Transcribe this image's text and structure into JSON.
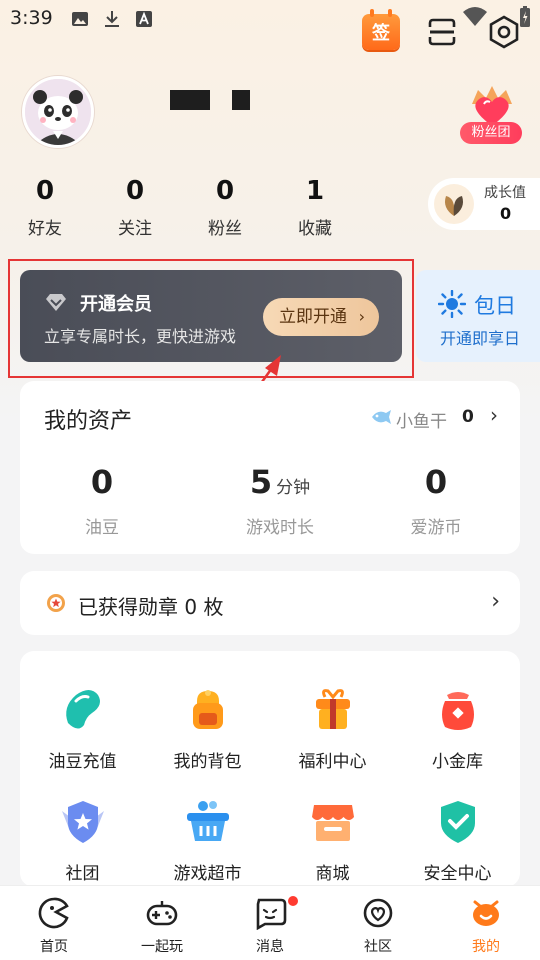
{
  "status_bar": {
    "time": "3:39"
  },
  "header": {
    "sign_label": "签"
  },
  "profile": {
    "fans_club_label": "粉丝团"
  },
  "stats": [
    {
      "value": "0",
      "label": "好友"
    },
    {
      "value": "0",
      "label": "关注"
    },
    {
      "value": "0",
      "label": "粉丝"
    },
    {
      "value": "1",
      "label": "收藏"
    }
  ],
  "growth": {
    "label": "成长值",
    "value": "0"
  },
  "membership": {
    "title": "开通会员",
    "description": "立享专属时长，更快进游戏",
    "button": "立即开通",
    "button_chevron": "›"
  },
  "package": {
    "title": "包日",
    "description": "开通即享日"
  },
  "assets": {
    "title": "我的资产",
    "fish_label": "小鱼干",
    "fish_value": "0",
    "chevron": "›",
    "items": [
      {
        "value": "0",
        "unit": "",
        "label": "油豆"
      },
      {
        "value": "5",
        "unit": "分钟",
        "label": "游戏时长"
      },
      {
        "value": "0",
        "unit": "",
        "label": "爱游币"
      }
    ]
  },
  "medal": {
    "text": "已获得勋章 0 枚",
    "chevron": "›"
  },
  "services": [
    {
      "label": "油豆充值",
      "icon": "bean-icon"
    },
    {
      "label": "我的背包",
      "icon": "backpack-icon"
    },
    {
      "label": "福利中心",
      "icon": "gift-icon"
    },
    {
      "label": "小金库",
      "icon": "vault-icon"
    },
    {
      "label": "社团",
      "icon": "club-icon"
    },
    {
      "label": "游戏超市",
      "icon": "basket-icon"
    },
    {
      "label": "商城",
      "icon": "store-icon"
    },
    {
      "label": "安全中心",
      "icon": "shield-icon"
    }
  ],
  "tabs": [
    {
      "label": "首页",
      "icon": "home-icon"
    },
    {
      "label": "一起玩",
      "icon": "gamepad-icon"
    },
    {
      "label": "消息",
      "icon": "message-icon"
    },
    {
      "label": "社区",
      "icon": "community-icon"
    },
    {
      "label": "我的",
      "icon": "mine-icon",
      "active": true
    }
  ],
  "colors": {
    "accent": "#ff7a1a",
    "annotation": "#e53535",
    "member_dark": "#4a4d57",
    "badge_red": "#ff3d5c"
  }
}
